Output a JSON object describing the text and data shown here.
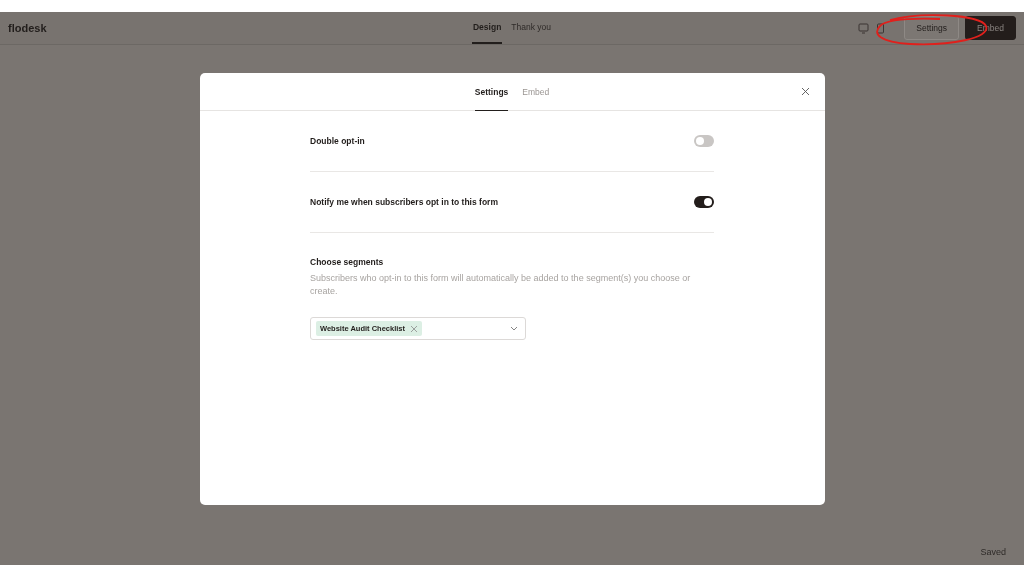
{
  "app": {
    "logo": "flodesk",
    "tabs": [
      {
        "label": "Design",
        "selected": true
      },
      {
        "label": "Thank you",
        "selected": false
      }
    ],
    "buttons": [
      {
        "label": "Settings",
        "kind": "outline"
      },
      {
        "label": "Embed",
        "kind": "primary"
      }
    ],
    "status": "Saved"
  },
  "modal": {
    "tabs": [
      {
        "label": "Settings",
        "selected": true
      },
      {
        "label": "Embed",
        "selected": false
      }
    ],
    "settings": [
      {
        "label": "Double opt-in",
        "on": false
      },
      {
        "label": "Notify me when subscribers opt in to this form",
        "on": true
      }
    ],
    "segments": {
      "title": "Choose segments",
      "description": "Subscribers who opt-in to this form will automatically be added to the segment(s) you choose or create.",
      "selected": [
        {
          "label": "Website Audit Checklist"
        }
      ]
    }
  }
}
